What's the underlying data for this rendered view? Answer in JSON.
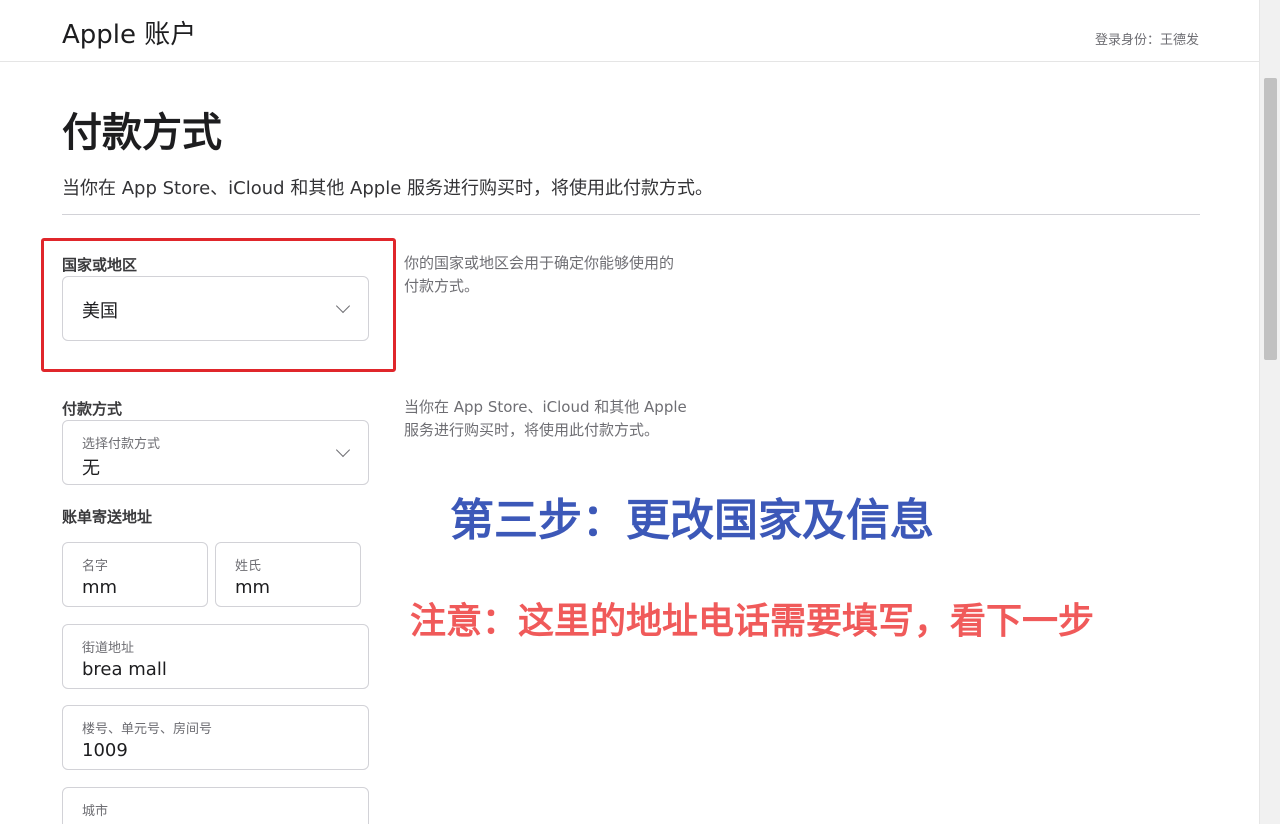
{
  "header": {
    "brand": "Apple 账户",
    "login_label": "登录身份：王德发"
  },
  "page": {
    "title": "付款方式",
    "description": "当你在 App Store、iCloud 和其他 Apple 服务进行购买时，将使用此付款方式。"
  },
  "country": {
    "label": "国家或地区",
    "value": "美国",
    "note": [
      "你的国家或地区会用于确定你能够使用的",
      "付款方式。"
    ]
  },
  "payment": {
    "label": "付款方式",
    "placeholder": "选择付款方式",
    "value": "无",
    "note": [
      "当你在 App Store、iCloud 和其他 Apple",
      "服务进行购买时，将使用此付款方式。"
    ]
  },
  "billing": {
    "label": "账单寄送地址",
    "first_name": {
      "placeholder": "名字",
      "value": "mm"
    },
    "last_name": {
      "placeholder": "姓氏",
      "value": "mm"
    },
    "street": {
      "placeholder": "街道地址",
      "value": "brea mall"
    },
    "unit": {
      "placeholder": "楼号、单元号、房间号",
      "value": "1009"
    },
    "city": {
      "placeholder": "城市",
      "value": ""
    }
  },
  "annotations": {
    "step": "第三步：更改国家及信息",
    "notice": "注意：这里的地址电话需要填写，看下一步"
  },
  "colors": {
    "highlight": "#e0262b",
    "step_text": "#3c58b8",
    "notice_text": "#f05a5a"
  }
}
